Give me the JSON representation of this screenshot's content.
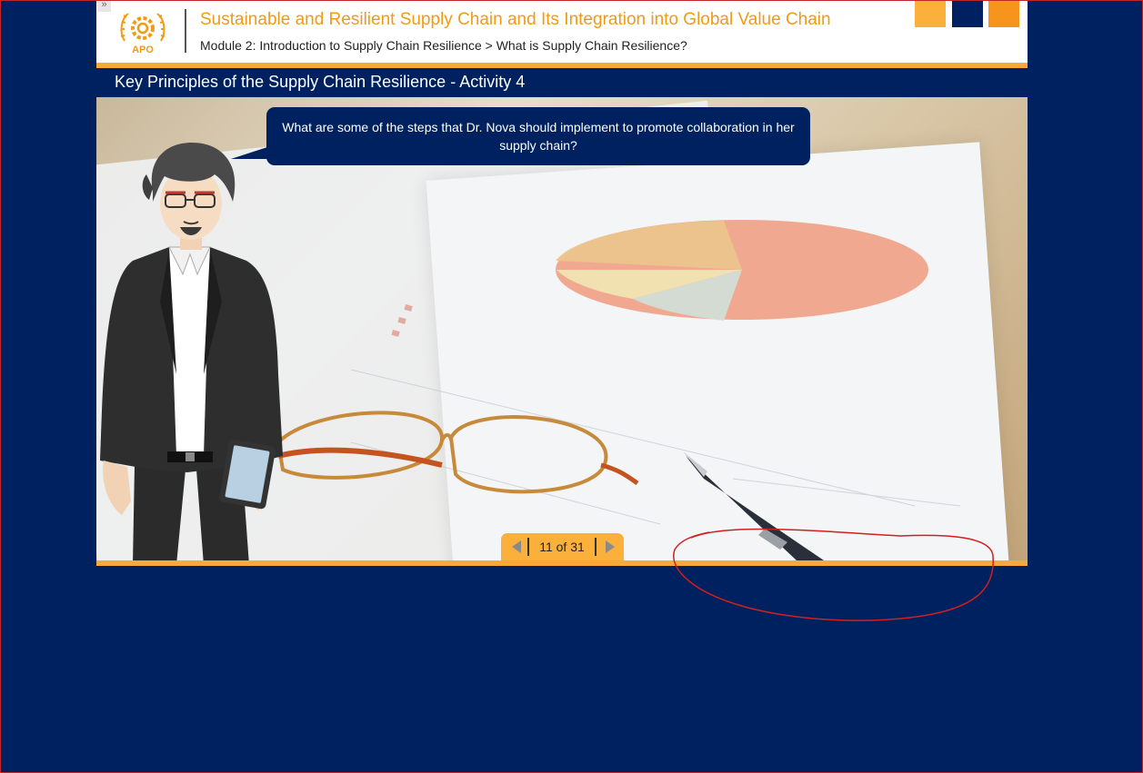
{
  "header": {
    "course_title": "Sustainable and Resilient Supply Chain and Its Integration into Global Value Chain",
    "breadcrumb": "Module 2: Introduction to Supply Chain Resilience > What is Supply Chain Resilience?",
    "logo_text": "APO"
  },
  "slide": {
    "title": "Key Principles of the Supply Chain Resilience - Activity 4",
    "speech": "What are some of the steps that Dr. Nova should implement to promote collaboration in her supply chain?"
  },
  "nav": {
    "counter": "11 of 31",
    "prev_icon": "triangle-left-icon",
    "next_icon": "triangle-right-icon"
  },
  "colors": {
    "navy": "#00215f",
    "orange": "#f29a14",
    "light_orange": "#fbb03b",
    "annotation_red": "#d21f1f"
  }
}
